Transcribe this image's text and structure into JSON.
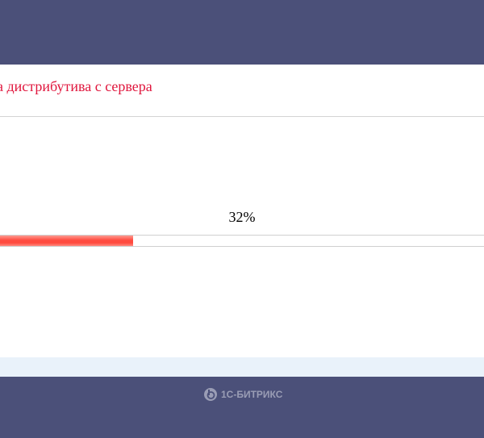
{
  "installer": {
    "step_title": "а дистрибутива с сервера",
    "progress_percent": 32,
    "progress_label": "32%"
  },
  "footer": {
    "logo_text": "1С-БИТРИКС"
  },
  "colors": {
    "header": "#4b5079",
    "title": "#e0163d",
    "bar": "#ff4b40"
  }
}
